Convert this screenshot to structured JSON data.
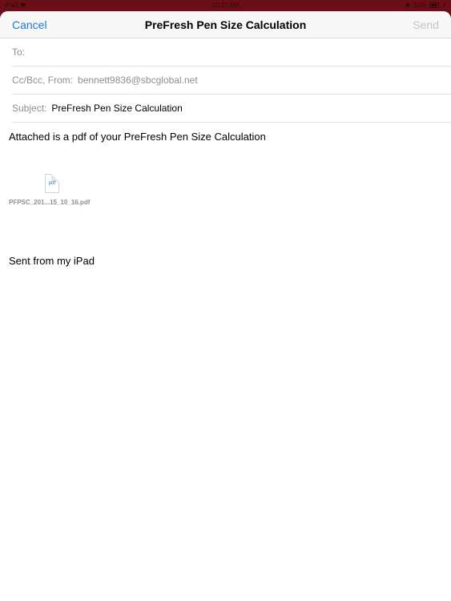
{
  "status_bar": {
    "carrier": "iPad",
    "time": "10:37 AM",
    "battery": "51%"
  },
  "navbar": {
    "cancel_label": "Cancel",
    "title": "PreFresh Pen Size Calculation",
    "send_label": "Send"
  },
  "fields": {
    "to_label": "To:",
    "to_value": "",
    "ccbcc_label": "Cc/Bcc, From:",
    "from_value": "bennett9836@sbcglobal.net",
    "subject_label": "Subject:",
    "subject_value": "PreFresh Pen Size Calculation"
  },
  "body": {
    "text": "Attached is a pdf of your PreFresh Pen Size Calculation",
    "attachment": {
      "icon_label": "pdf",
      "filename": "PFPSC_201...15_10_16.pdf"
    },
    "signature": "Sent from my iPad"
  },
  "colors": {
    "accent": "#1a7bd6",
    "status_bar_bg": "#6a0f17",
    "disabled": "#c4c4c4",
    "secondary_text": "#8e8e93"
  }
}
